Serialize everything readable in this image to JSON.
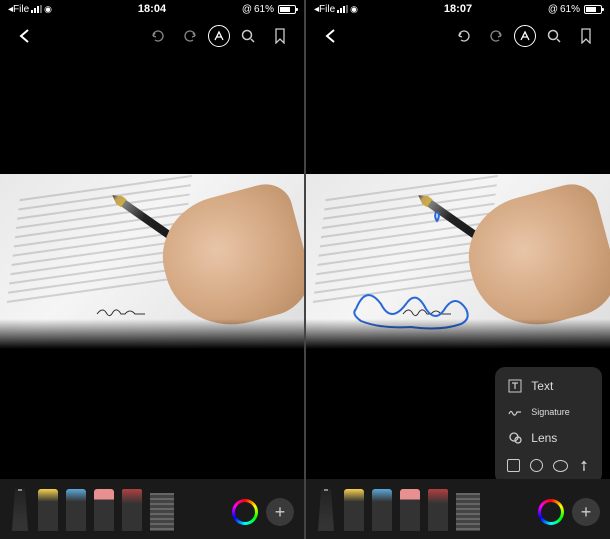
{
  "left": {
    "status": {
      "back_app": "◂File",
      "time": "18:04",
      "battery_pct": "61%",
      "battery_icon_prefix": "@"
    },
    "toolbar": {}
  },
  "right": {
    "status": {
      "back_app": "◂File",
      "time": "18:07",
      "battery_pct": "61%",
      "battery_icon_prefix": "@"
    },
    "popup": {
      "text_label": "Text",
      "signature_label": "Signature",
      "lens_label": "Lens"
    }
  }
}
